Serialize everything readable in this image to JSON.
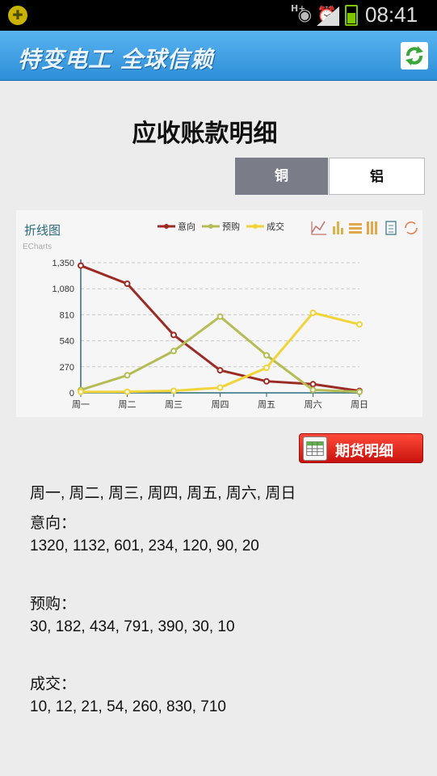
{
  "status_bar": {
    "clock": "08:41",
    "network": "H+",
    "icons": [
      "eye-icon",
      "alarm-icon",
      "signal-icon",
      "battery-icon"
    ]
  },
  "app_bar": {
    "brand": "特变电工 全球信赖",
    "refresh_icon": "refresh-icon"
  },
  "page": {
    "title": "应收账款明细"
  },
  "tabs": [
    {
      "label": "铜",
      "active": false
    },
    {
      "label": "铝",
      "active": true
    }
  ],
  "chart": {
    "title": "折线图",
    "subtitle": "ECharts",
    "toolbox_icons": [
      "line-chart-icon",
      "bar-chart-icon",
      "stack-icon",
      "tiled-icon",
      "data-view-icon",
      "restore-icon"
    ],
    "colors": {
      "yixiang": "#9b2b25",
      "yugou": "#b4bd55",
      "chengjiao": "#f0d43a"
    }
  },
  "chart_data": {
    "type": "line",
    "title": "折线图",
    "subtitle": "ECharts",
    "categories": [
      "周一",
      "周二",
      "周三",
      "周四",
      "周五",
      "周六",
      "周日"
    ],
    "series": [
      {
        "name": "意向",
        "values": [
          1320,
          1132,
          601,
          234,
          120,
          90,
          20
        ]
      },
      {
        "name": "预购",
        "values": [
          30,
          182,
          434,
          791,
          390,
          30,
          10
        ]
      },
      {
        "name": "成交",
        "values": [
          10,
          12,
          21,
          54,
          260,
          830,
          710
        ]
      }
    ],
    "yticks": [
      "0",
      "270",
      "540",
      "810",
      "1,080",
      "1,350"
    ],
    "ylim": [
      0,
      1350
    ],
    "grid": true,
    "legend_position": "top-right"
  },
  "futures_button": {
    "label": "期货明细",
    "icon": "spreadsheet-icon"
  },
  "data_text": {
    "categories_line": "周一, 周二, 周三, 周四, 周五, 周六, 周日",
    "yixiang_label": "意向：",
    "yixiang_values": "1320, 1132, 601, 234, 120, 90, 20",
    "yugou_label": "预购：",
    "yugou_values": "30, 182, 434, 791, 390, 30, 10",
    "chengjiao_label": "成交：",
    "chengjiao_values": "10, 12, 21, 54, 260, 830, 710"
  }
}
